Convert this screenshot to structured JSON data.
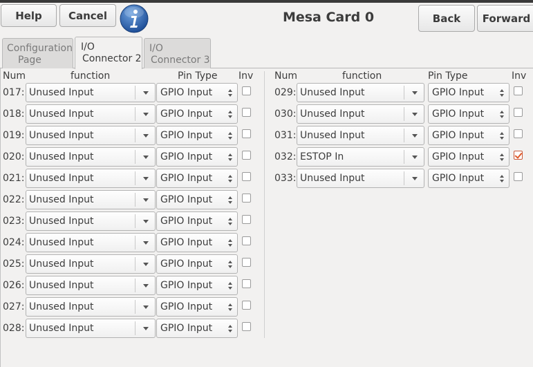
{
  "toolbar": {
    "help_label": "Help",
    "cancel_label": "Cancel",
    "back_label": "Back",
    "forward_label": "Forward",
    "info_icon": "info-icon"
  },
  "page_title": "Mesa Card 0",
  "tabs": [
    {
      "line1": "Configuration",
      "line2": "Page",
      "active": false
    },
    {
      "line1": "I/O",
      "line2": "Connector 2",
      "active": true
    },
    {
      "line1": "I/O",
      "line2": "Connector 3",
      "active": false
    }
  ],
  "columns": {
    "num": "Num",
    "function": "function",
    "pin_type": "Pin Type",
    "inv": "Inv"
  },
  "left_rows": [
    {
      "num": "017:",
      "function": "Unused Input",
      "pin_type": "GPIO Input",
      "inv": false
    },
    {
      "num": "018:",
      "function": "Unused Input",
      "pin_type": "GPIO Input",
      "inv": false
    },
    {
      "num": "019:",
      "function": "Unused Input",
      "pin_type": "GPIO Input",
      "inv": false
    },
    {
      "num": "020:",
      "function": "Unused Input",
      "pin_type": "GPIO Input",
      "inv": false
    },
    {
      "num": "021:",
      "function": "Unused Input",
      "pin_type": "GPIO Input",
      "inv": false
    },
    {
      "num": "022:",
      "function": "Unused Input",
      "pin_type": "GPIO Input",
      "inv": false
    },
    {
      "num": "023:",
      "function": "Unused Input",
      "pin_type": "GPIO Input",
      "inv": false
    },
    {
      "num": "024:",
      "function": "Unused Input",
      "pin_type": "GPIO Input",
      "inv": false
    },
    {
      "num": "025:",
      "function": "Unused Input",
      "pin_type": "GPIO Input",
      "inv": false
    },
    {
      "num": "026:",
      "function": "Unused Input",
      "pin_type": "GPIO Input",
      "inv": false
    },
    {
      "num": "027:",
      "function": "Unused Input",
      "pin_type": "GPIO Input",
      "inv": false
    },
    {
      "num": "028:",
      "function": "Unused Input",
      "pin_type": "GPIO Input",
      "inv": false
    }
  ],
  "right_rows": [
    {
      "num": "029:",
      "function": "Unused Input",
      "pin_type": "GPIO Input",
      "inv": false
    },
    {
      "num": "030:",
      "function": "Unused Input",
      "pin_type": "GPIO Input",
      "inv": false
    },
    {
      "num": "031:",
      "function": "Unused Input",
      "pin_type": "GPIO Input",
      "inv": false
    },
    {
      "num": "032:",
      "function": "ESTOP In",
      "pin_type": "GPIO Input",
      "inv": true
    },
    {
      "num": "033:",
      "function": "Unused Input",
      "pin_type": "GPIO Input",
      "inv": false
    }
  ],
  "colors": {
    "accent_check": "#e05a2a",
    "info_blue": "#3a6fb8"
  }
}
